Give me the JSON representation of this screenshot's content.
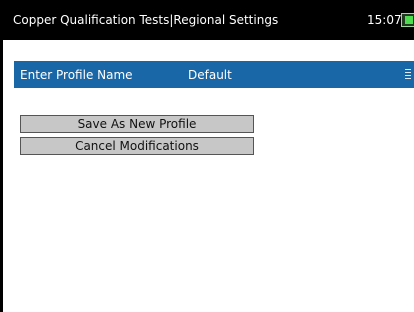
{
  "header": {
    "title": "Copper Qualification Tests|Regional Settings",
    "time": "15:07",
    "battery_icon": "battery-charging-icon",
    "background": "#000000"
  },
  "profile": {
    "label": "Enter Profile Name",
    "value": "Default",
    "bar_color": "#1a67a7",
    "grip_icon": "keypad-grip-icon"
  },
  "actions": {
    "save_label": "Save As New Profile",
    "cancel_label": "Cancel Modifications"
  }
}
